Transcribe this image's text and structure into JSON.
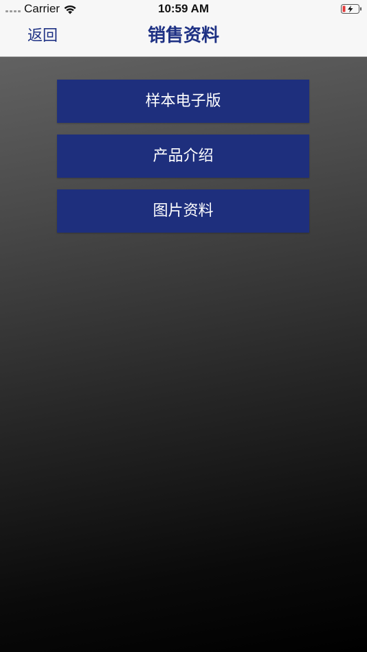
{
  "status_bar": {
    "carrier": "Carrier",
    "time": "10:59 AM"
  },
  "nav": {
    "back_label": "返回",
    "title": "销售资料"
  },
  "menu": {
    "items": [
      {
        "label": "样本电子版"
      },
      {
        "label": "产品介绍"
      },
      {
        "label": "图片资料"
      }
    ]
  },
  "colors": {
    "accent": "#1e3184",
    "button_bg": "#1e2f7d",
    "battery_low": "#e33b3b"
  },
  "icons": {
    "signal": "cellular-signal-icon",
    "wifi": "wifi-icon",
    "battery": "battery-charging-icon"
  }
}
